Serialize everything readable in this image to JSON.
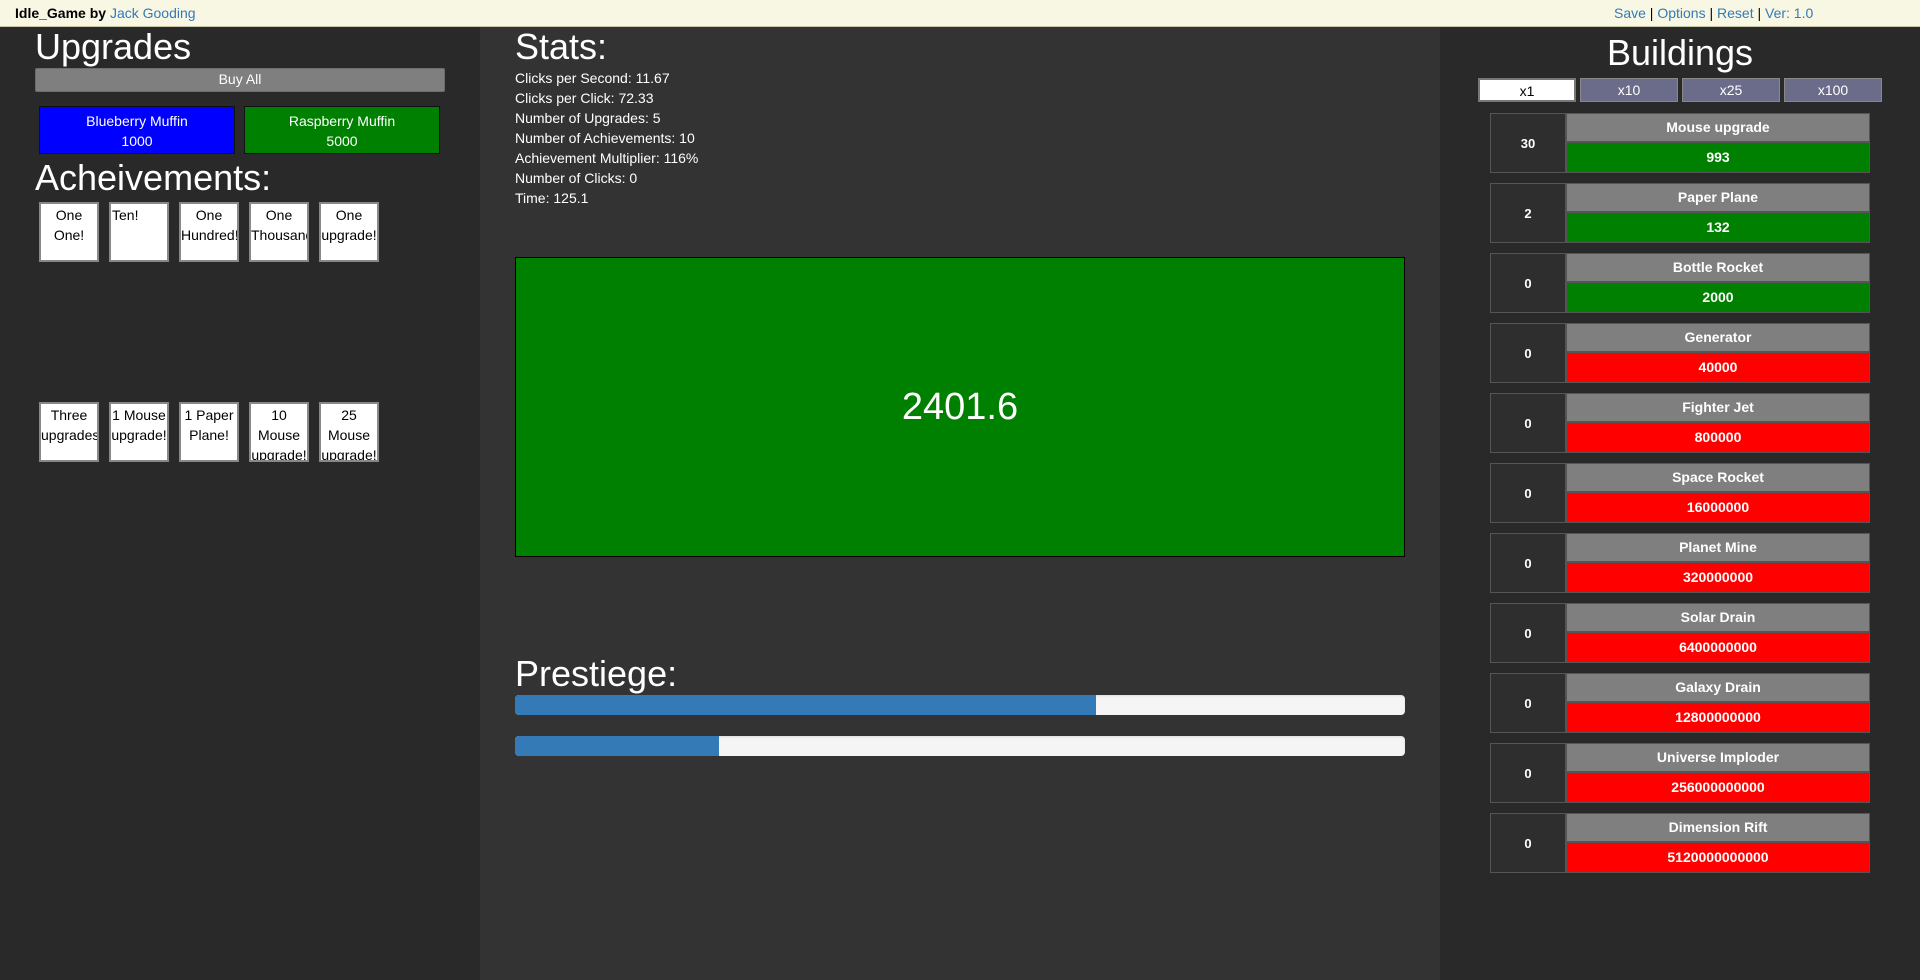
{
  "topbar": {
    "game_name": "Idle_Game",
    "by": " by ",
    "author": "Jack Gooding",
    "save": "Save",
    "sep": " | ",
    "options": "Options",
    "reset": "Reset",
    "version": "Ver: 1.0"
  },
  "upgrades": {
    "heading": "Upgrades",
    "buy_all": "Buy All",
    "items": [
      {
        "name": "Blueberry Muffin",
        "cost": "1000",
        "color": "#0000ff"
      },
      {
        "name": "Raspberry Muffin",
        "cost": "5000",
        "color": "#008000"
      }
    ]
  },
  "achievements": {
    "heading": "Acheivements:",
    "items": [
      {
        "line1": "One",
        "line2": "One!",
        "line3": ""
      },
      {
        "line1": "Ten!",
        "line2": "",
        "line3": ""
      },
      {
        "line1": "One",
        "line2": "Hundred!",
        "line3": ""
      },
      {
        "line1": "One",
        "line2": "Thousand",
        "line3": ""
      },
      {
        "line1": "One",
        "line2": "upgrade!",
        "line3": ""
      },
      {
        "line1": "Three",
        "line2": "upgrades",
        "line3": ""
      },
      {
        "line1": "1 Mouse",
        "line2": "upgrade!",
        "line3": ""
      },
      {
        "line1": "1 Paper",
        "line2": "Plane!",
        "line3": ""
      },
      {
        "line1": "10",
        "line2": "Mouse",
        "line3": "upgrade!"
      },
      {
        "line1": "25",
        "line2": "Mouse",
        "line3": "upgrade!"
      }
    ]
  },
  "stats": {
    "heading": "Stats:",
    "lines": [
      "Clicks per Second: 11.67",
      "Clicks per Click: 72.33",
      "Number of Upgrades: 5",
      "Number of Achievements: 10",
      "Achievement Multiplier: 116%",
      "Number of Clicks: 0",
      "Time: 125.1"
    ]
  },
  "clicker": {
    "value": "2401.6",
    "color": "#008000"
  },
  "prestige": {
    "heading": "Prestiege:",
    "progress": [
      0.653,
      0.229
    ],
    "bar_color": "#337ab7"
  },
  "buildings": {
    "heading": "Buildings",
    "multipliers": [
      "x1",
      "x10",
      "x25",
      "x100"
    ],
    "selected_multiplier": "x1",
    "affordable_color": "#008000",
    "unaffordable_color": "#ff0000",
    "items": [
      {
        "count": "30",
        "name": "Mouse upgrade",
        "cost": "993",
        "affordable": true
      },
      {
        "count": "2",
        "name": "Paper Plane",
        "cost": "132",
        "affordable": true
      },
      {
        "count": "0",
        "name": "Bottle Rocket",
        "cost": "2000",
        "affordable": true
      },
      {
        "count": "0",
        "name": "Generator",
        "cost": "40000",
        "affordable": false
      },
      {
        "count": "0",
        "name": "Fighter Jet",
        "cost": "800000",
        "affordable": false
      },
      {
        "count": "0",
        "name": "Space Rocket",
        "cost": "16000000",
        "affordable": false
      },
      {
        "count": "0",
        "name": "Planet Mine",
        "cost": "320000000",
        "affordable": false
      },
      {
        "count": "0",
        "name": "Solar Drain",
        "cost": "6400000000",
        "affordable": false
      },
      {
        "count": "0",
        "name": "Galaxy Drain",
        "cost": "12800000000",
        "affordable": false
      },
      {
        "count": "0",
        "name": "Universe Imploder",
        "cost": "256000000000",
        "affordable": false
      },
      {
        "count": "0",
        "name": "Dimension Rift",
        "cost": "5120000000000",
        "affordable": false
      }
    ]
  }
}
